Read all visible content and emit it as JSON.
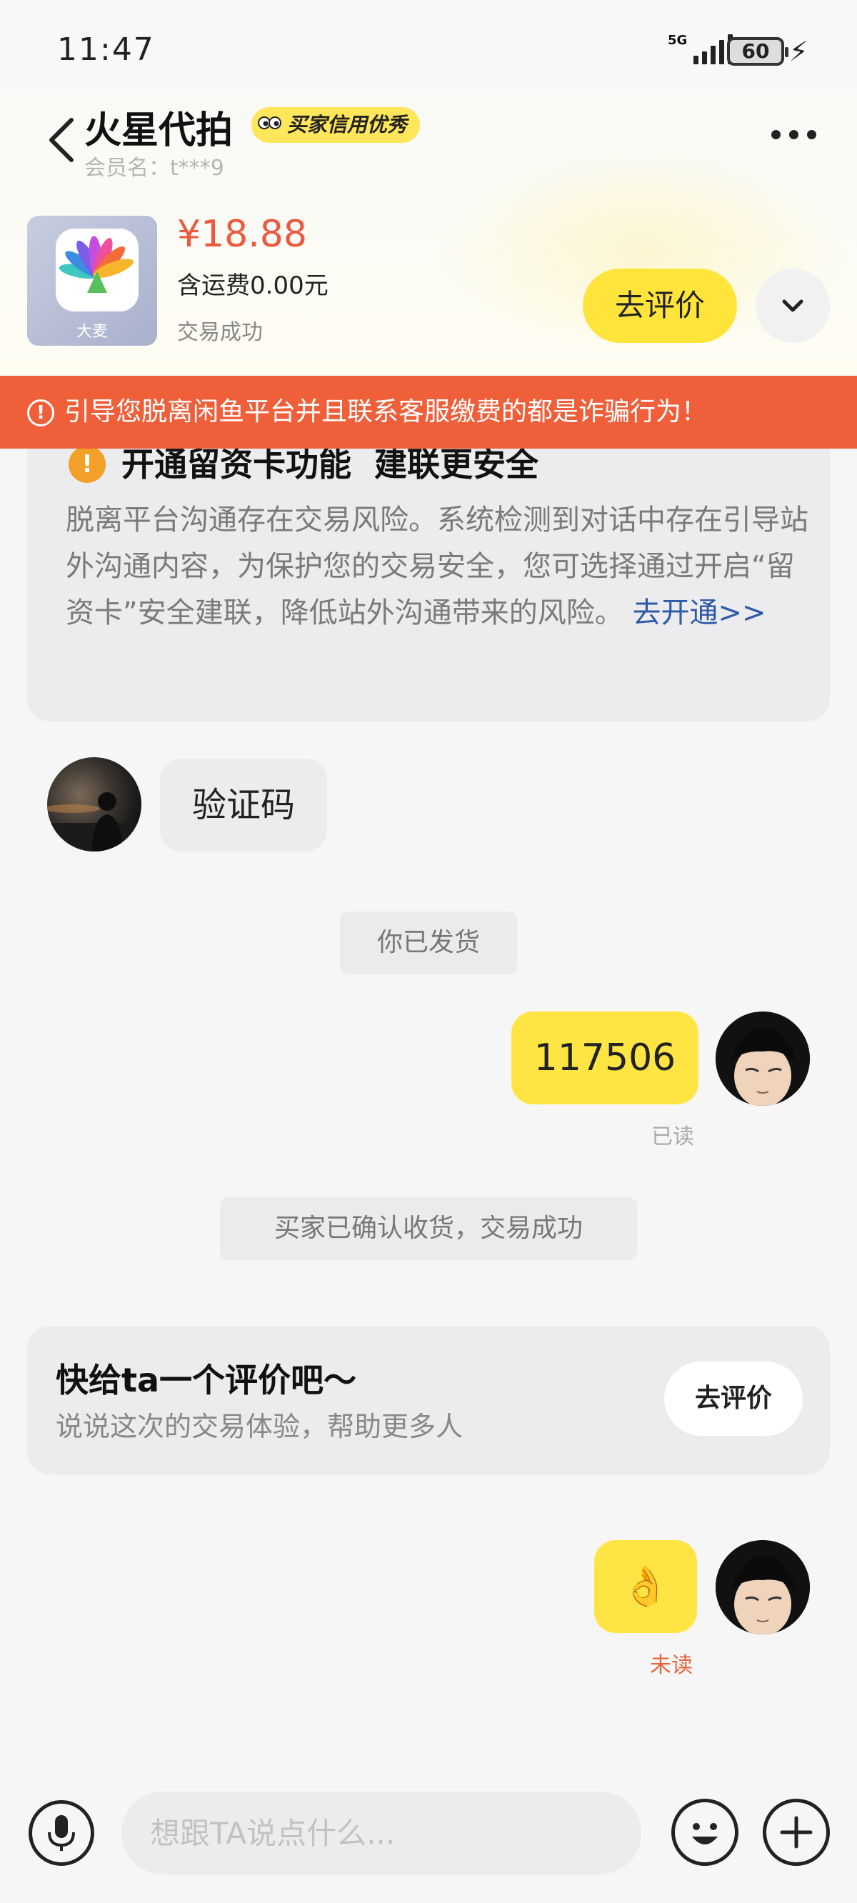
{
  "status_bar": {
    "time": "11:47",
    "network": "5G",
    "battery": "60"
  },
  "header": {
    "shop_name": "火星代拍",
    "credit_badge": "买家信用优秀",
    "member_label": "会员名：t***9"
  },
  "product": {
    "brand": "大麦",
    "price": "¥18.88",
    "shipping": "含运费0.00元",
    "status": "交易成功",
    "review_button": "去评价"
  },
  "warning_banner": {
    "icon": "alert-circle-icon",
    "text": "引导您脱离闲鱼平台并且联系客服缴费的都是诈骗行为！"
  },
  "notice_card": {
    "icon": "exclamation-icon",
    "title": "开通留资卡功能  建联更安全",
    "body": "脱离平台沟通存在交易风险。系统检测到对话中存在引导站外沟通内容，为保护您的交易安全，您可选择通过开启“留资卡”安全建联，降低站外沟通带来的风险。",
    "link": "去开通>>"
  },
  "messages": {
    "incoming_text": "验证码",
    "system_shipped": "你已发货",
    "outgoing_code": "117506",
    "outgoing_code_state": "已读",
    "system_confirmed": "买家已确认收货，交易成功",
    "outgoing_emoji": "👌",
    "outgoing_emoji_state": "未读"
  },
  "review_card": {
    "title": "快给ta一个评价吧～",
    "subtitle": "说说这次的交易体验，帮助更多人",
    "button": "去评价"
  },
  "input_bar": {
    "placeholder": "想跟TA说点什么..."
  },
  "colors": {
    "accent_yellow": "#ffe544",
    "price_red": "#e95a3f",
    "warning_orange": "#ee5f3a",
    "link_blue": "#2e5aa7",
    "unread_orange": "#e8643c"
  }
}
